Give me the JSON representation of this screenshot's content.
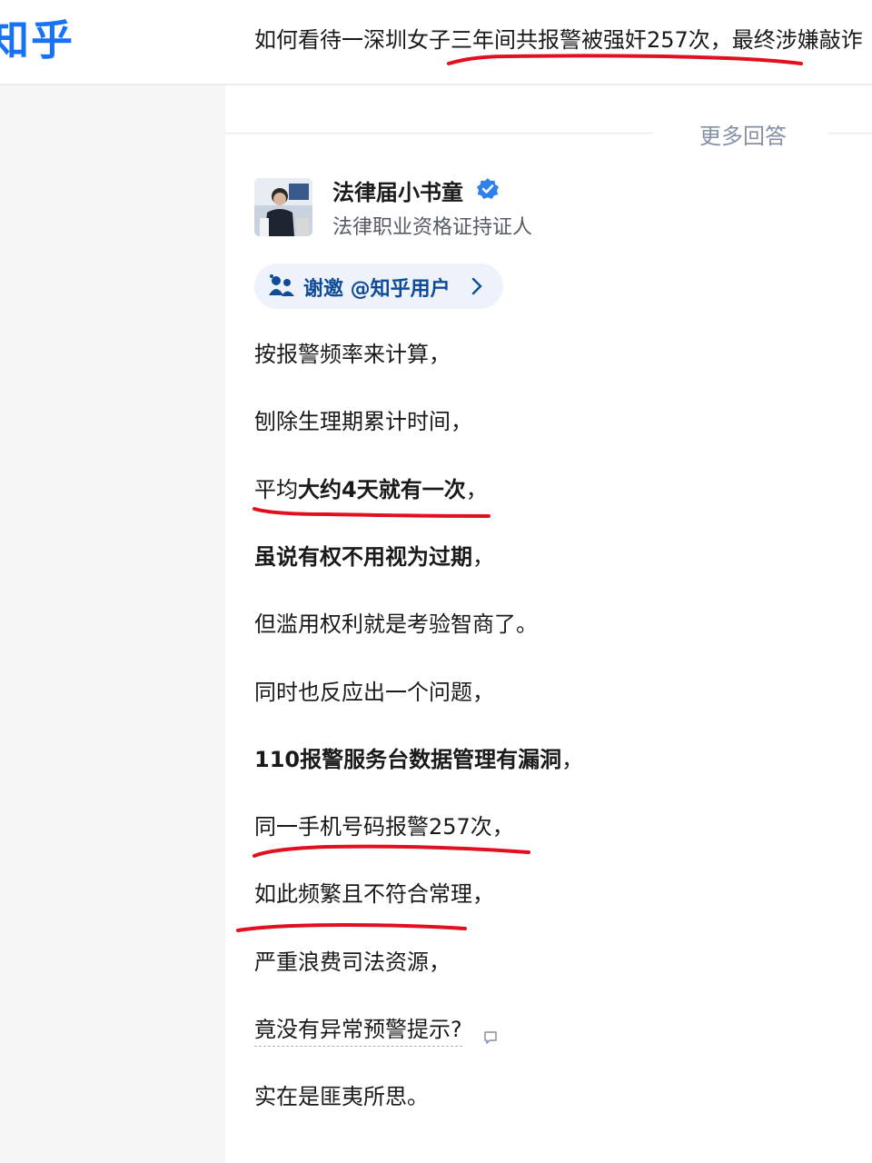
{
  "header": {
    "logo": "知乎",
    "question_title": "如何看待一深圳女子三年间共报警被强奸257次，最终涉嫌敲诈"
  },
  "answers_nav": {
    "more_answers_label": "更多回答"
  },
  "author": {
    "name": "法律届小书童",
    "description": "法律职业资格证持证人"
  },
  "invite": {
    "prefix": "谢邀 @",
    "user": "知乎用户"
  },
  "paragraphs": {
    "p1": "按报警频率来计算，",
    "p2": "刨除生理期累计时间，",
    "p3_normal": "平均",
    "p3_bold": "大约4天就有一次",
    "p3_end": "，",
    "p4_bold": "虽说有权不用视为过期",
    "p4_end": "，",
    "p5": "但滥用权利就是考验智商了。",
    "p6": "同时也反应出一个问题，",
    "p7_bold": "110报警服务台数据管理有漏洞",
    "p7_end": "，",
    "p8": "同一手机号码报警257次，",
    "p9": "如此频繁且不符合常理，",
    "p10": "严重浪费司法资源，",
    "p11": "竟没有异常预警提示?",
    "p12": "实在是匪夷所思。"
  },
  "colors": {
    "brand_blue": "#1772f6",
    "annotation_red": "#e0101f",
    "verified_blue": "#2f80ed"
  }
}
